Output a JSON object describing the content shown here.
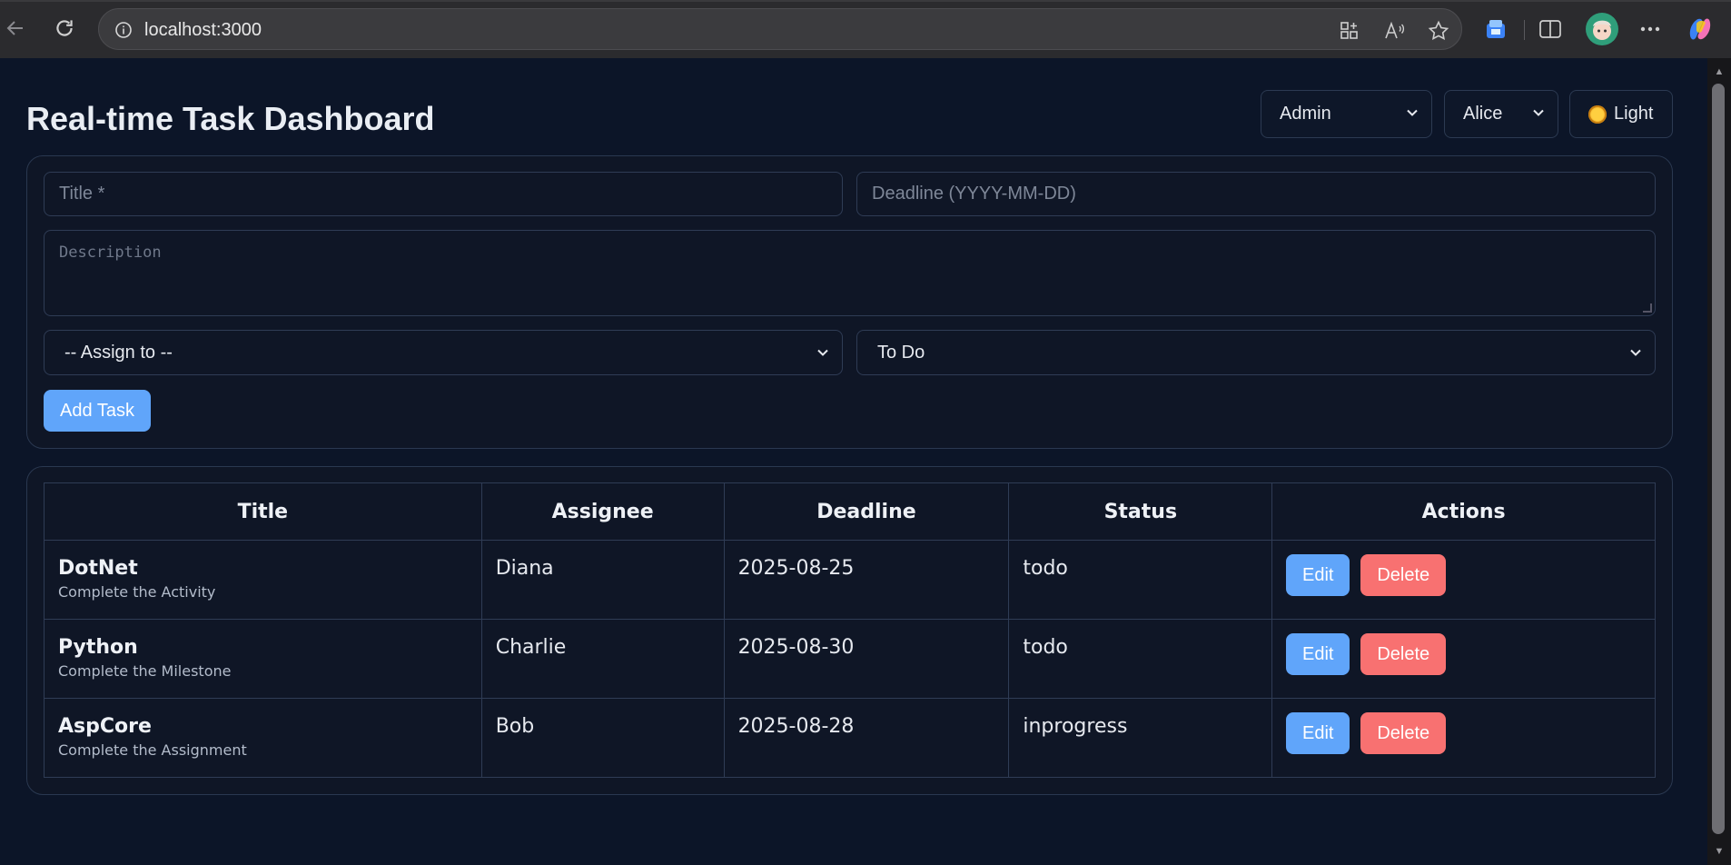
{
  "browser": {
    "url": "localhost:3000"
  },
  "header": {
    "title": "Real-time Task Dashboard",
    "role_select": "Admin",
    "user_select": "Alice",
    "theme_button": "Light"
  },
  "form": {
    "title_placeholder": "Title *",
    "deadline_placeholder": "Deadline (YYYY-MM-DD)",
    "description_placeholder": "Description",
    "assign_select": "-- Assign to --",
    "status_select": "To Do",
    "add_button": "Add Task"
  },
  "table": {
    "headers": [
      "Title",
      "Assignee",
      "Deadline",
      "Status",
      "Actions"
    ],
    "rows": [
      {
        "title": "DotNet",
        "desc": "Complete the Activity",
        "assignee": "Diana",
        "deadline": "2025-08-25",
        "status": "todo"
      },
      {
        "title": "Python",
        "desc": "Complete the Milestone",
        "assignee": "Charlie",
        "deadline": "2025-08-30",
        "status": "todo"
      },
      {
        "title": "AspCore",
        "desc": "Complete the Assignment",
        "assignee": "Bob",
        "deadline": "2025-08-28",
        "status": "inprogress"
      }
    ],
    "edit_label": "Edit",
    "delete_label": "Delete"
  },
  "colors": {
    "accent": "#60a5fa",
    "danger": "#f87171",
    "background": "#0c1528"
  }
}
